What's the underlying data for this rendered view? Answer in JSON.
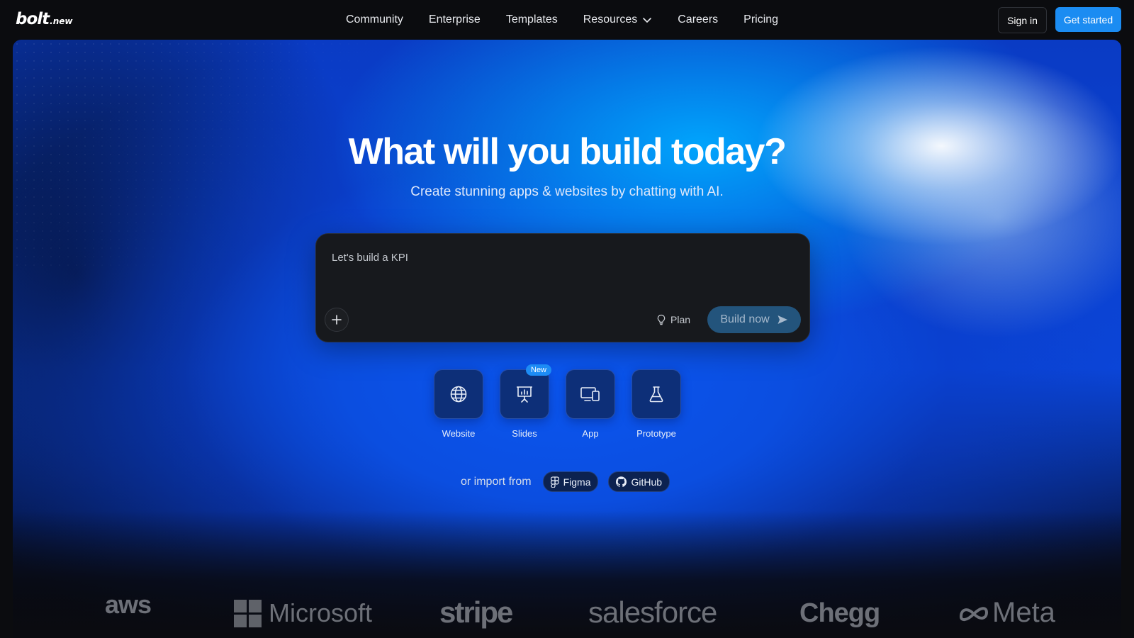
{
  "header": {
    "logo_main": "bolt",
    "logo_suffix": ".new",
    "nav": [
      {
        "label": "Community"
      },
      {
        "label": "Enterprise"
      },
      {
        "label": "Templates"
      },
      {
        "label": "Resources"
      },
      {
        "label": "Careers"
      },
      {
        "label": "Pricing"
      }
    ],
    "sign_in": "Sign in",
    "get_started": "Get started"
  },
  "hero": {
    "title": "What will you build today?",
    "subtitle": "Create stunning apps & websites by chatting with AI."
  },
  "prompt": {
    "value": "Let's build a KPI",
    "plan_label": "Plan",
    "build_label": "Build now"
  },
  "types": [
    {
      "label": "Website",
      "icon": "globe-icon"
    },
    {
      "label": "Slides",
      "icon": "presentation-icon",
      "badge": "New"
    },
    {
      "label": "App",
      "icon": "devices-icon"
    },
    {
      "label": "Prototype",
      "icon": "flask-icon"
    }
  ],
  "import": {
    "label": "or import from",
    "figma": "Figma",
    "github": "GitHub"
  },
  "logos": [
    "aws",
    "Microsoft",
    "stripe",
    "salesforce",
    "Chegg",
    "Meta"
  ],
  "colors": {
    "accent": "#1b8cf2",
    "hero_blue": "#0b4ee0",
    "panel": "#17191d"
  }
}
